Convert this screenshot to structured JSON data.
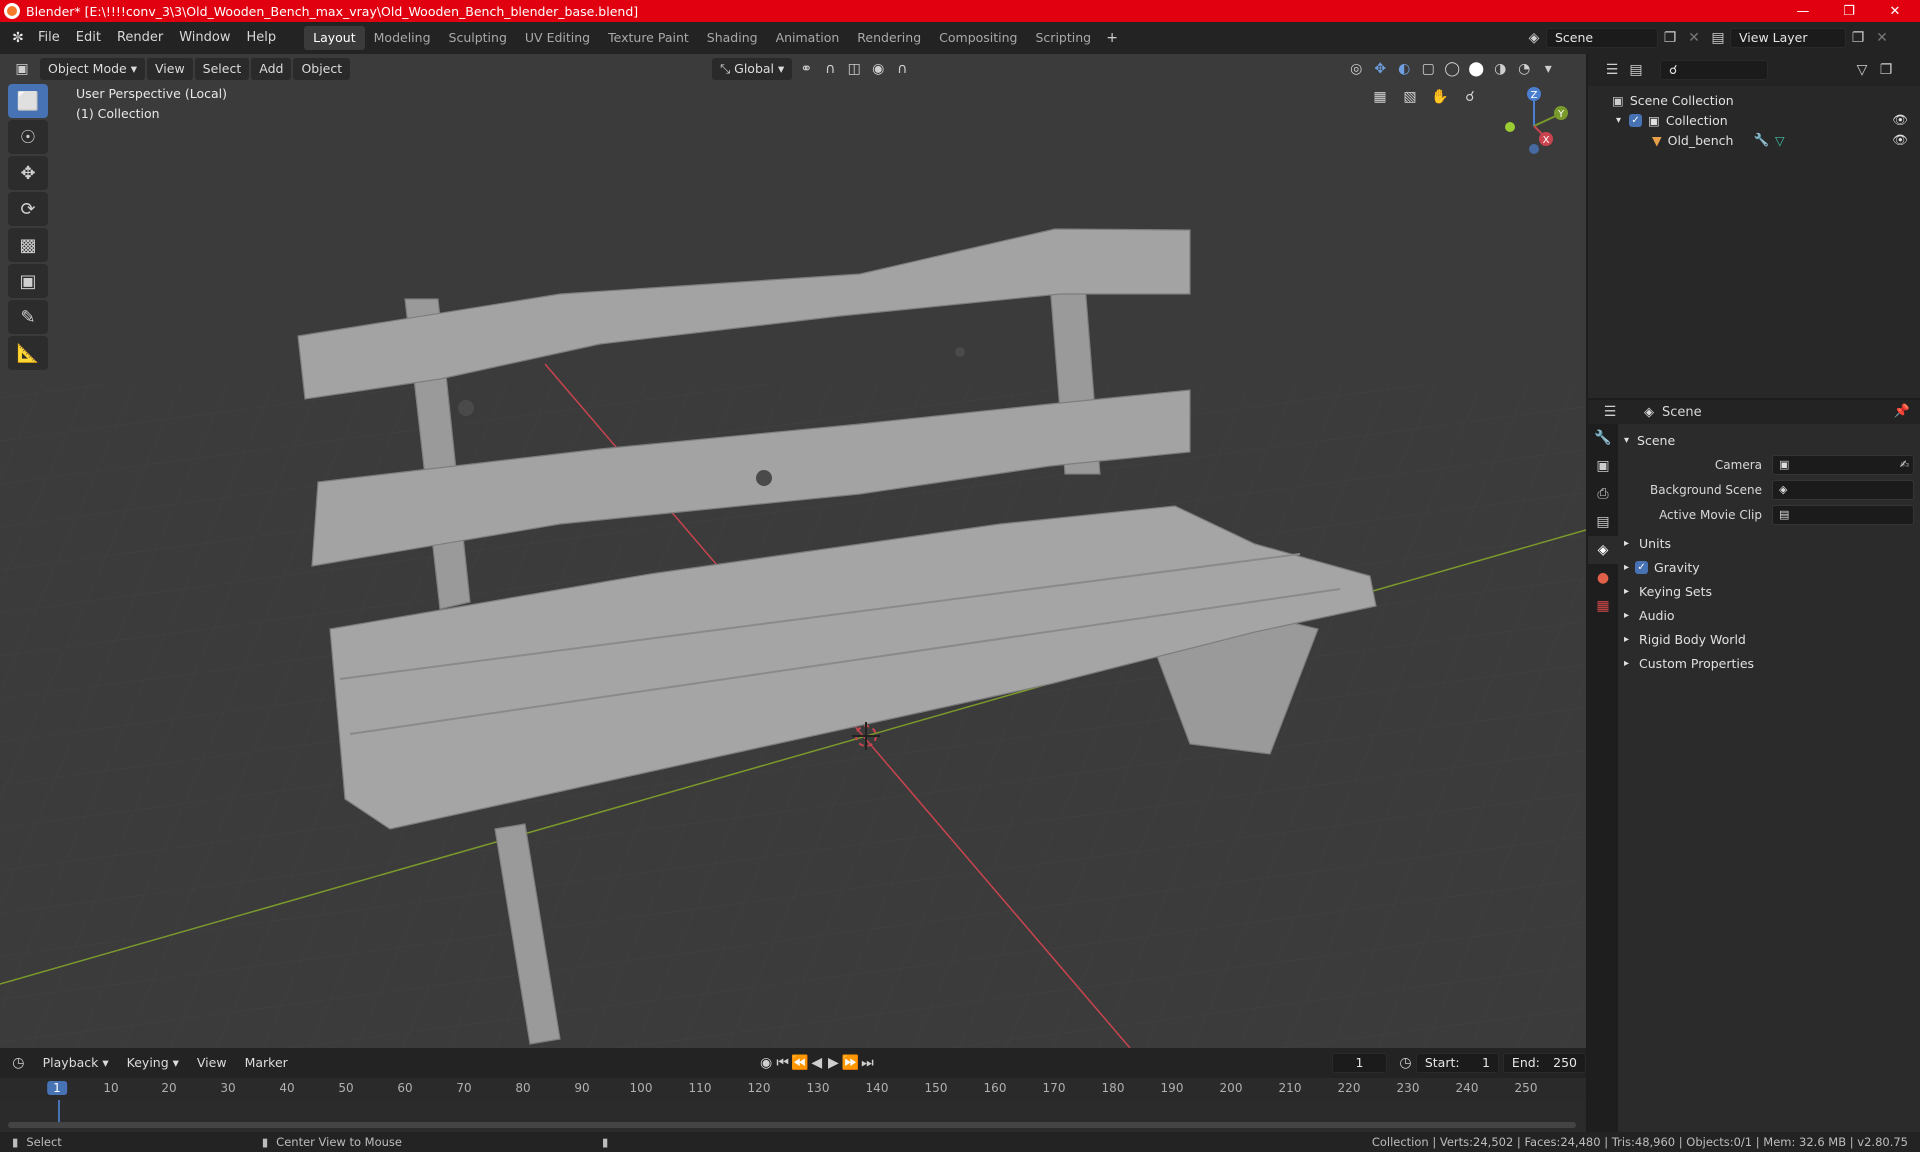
{
  "window": {
    "title": "Blender* [E:\\!!!!conv_3\\3\\Old_Wooden_Bench_max_vray\\Old_Wooden_Bench_blender_base.blend]"
  },
  "menu": [
    "File",
    "Edit",
    "Render",
    "Window",
    "Help"
  ],
  "workspaces": [
    "Layout",
    "Modeling",
    "Sculpting",
    "UV Editing",
    "Texture Paint",
    "Shading",
    "Animation",
    "Rendering",
    "Compositing",
    "Scripting"
  ],
  "active_workspace": "Layout",
  "scene_field": "Scene",
  "view_layer_field": "View Layer",
  "viewport": {
    "mode": "Object Mode",
    "menus": [
      "View",
      "Select",
      "Add",
      "Object"
    ],
    "transform_orientation": "Global",
    "info_line1": "User Perspective (Local)",
    "info_line2": "(1) Collection",
    "gizmo": {
      "x": "X",
      "y": "Y",
      "z": "Z"
    },
    "colors": {
      "bg": "#3b3b3b",
      "grid": "#454545",
      "x_axis": "#c9444f",
      "y_axis": "#7a9a2c",
      "mesh": "#9a9a9a"
    }
  },
  "outliner": {
    "root": "Scene Collection",
    "collection": "Collection",
    "object": "Old_bench"
  },
  "properties": {
    "header": "Scene",
    "section": "Scene",
    "rows": [
      {
        "label": "Camera"
      },
      {
        "label": "Background Scene"
      },
      {
        "label": "Active Movie Clip"
      }
    ],
    "panels": [
      "Units",
      "Gravity",
      "Keying Sets",
      "Audio",
      "Rigid Body World",
      "Custom Properties"
    ]
  },
  "timeline": {
    "menus": [
      "Playback",
      "Keying",
      "View",
      "Marker"
    ],
    "current_frame": "1",
    "start_label": "Start:",
    "start": "1",
    "end_label": "End:",
    "end": "250",
    "ticks": [
      "1",
      "10",
      "20",
      "30",
      "40",
      "50",
      "60",
      "70",
      "80",
      "90",
      "100",
      "110",
      "120",
      "130",
      "140",
      "150",
      "160",
      "170",
      "180",
      "190",
      "200",
      "210",
      "220",
      "230",
      "240",
      "250"
    ]
  },
  "status": {
    "select": "Select",
    "center": "Center View to Mouse",
    "stats": "Collection | Verts:24,502 | Faces:24,480 | Tris:48,960 | Objects:0/1 | Mem: 32.6 MB | v2.80.75"
  },
  "accent": "#4772b3"
}
